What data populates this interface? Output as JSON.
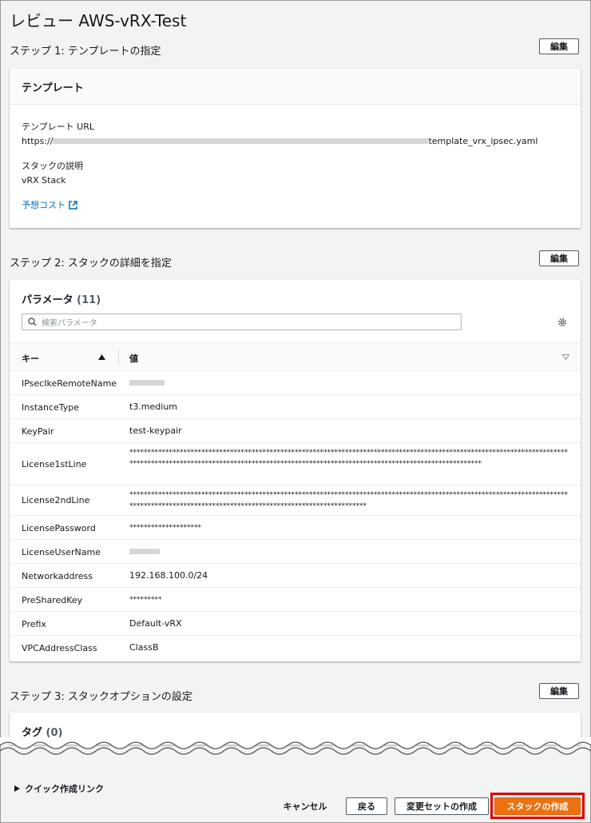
{
  "page": {
    "title": "レビュー AWS-vRX-Test"
  },
  "step1": {
    "title": "ステップ 1: テンプレートの指定",
    "edit_label": "編集",
    "card_title": "テンプレート",
    "url_label": "テンプレート URL",
    "url_prefix": "https://",
    "url_suffix": "template_vrx_ipsec.yaml",
    "description_label": "スタックの説明",
    "description_value": "vRX Stack",
    "cost_link": "予想コスト"
  },
  "step2": {
    "title": "ステップ 2: スタックの詳細を指定",
    "edit_label": "編集",
    "card_title": "パラメータ",
    "card_count": "(11)",
    "search_placeholder": "検索パラメータ",
    "col_key": "キー",
    "col_value": "値",
    "rows": [
      {
        "key": "IPsecIkeRemoteName",
        "value": ""
      },
      {
        "key": "InstanceType",
        "value": "t3.medium"
      },
      {
        "key": "KeyPair",
        "value": "test-keypair"
      },
      {
        "key": "License1stLine",
        "value": "****************************************************************************************************************************************************************************************************************************"
      },
      {
        "key": "License2ndLine",
        "value": "********************************************************************************************************************************************************************************************"
      },
      {
        "key": "LicensePassword",
        "value": "********************"
      },
      {
        "key": "LicenseUserName",
        "value": ""
      },
      {
        "key": "Networkaddress",
        "value": "192.168.100.0/24"
      },
      {
        "key": "PreSharedKey",
        "value": "*********"
      },
      {
        "key": "Prefix",
        "value": "Default-vRX"
      },
      {
        "key": "VPCAddressClass",
        "value": "ClassB"
      }
    ]
  },
  "step3": {
    "title": "ステップ 3: スタックオプションの設定",
    "edit_label": "編集",
    "card_title": "タグ",
    "card_count": "(0)"
  },
  "footer": {
    "quick_link": "クイック作成リンク",
    "cancel": "キャンセル",
    "back": "戻る",
    "changeset": "変更セットの作成",
    "create": "スタックの作成"
  },
  "colors": {
    "primary": "#ec7211",
    "link": "#0073bb",
    "highlight": "#e00000"
  }
}
